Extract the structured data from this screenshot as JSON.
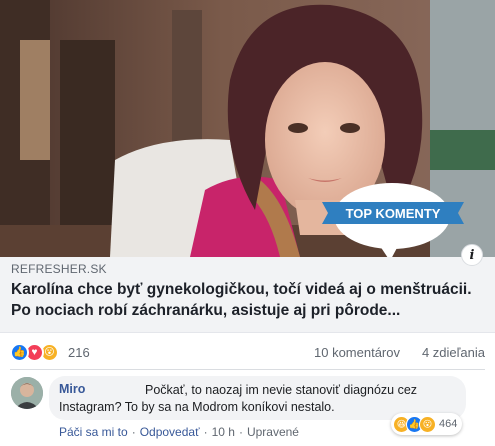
{
  "link_preview": {
    "domain": "REFRESHER.SK",
    "title": "Karolína chce byť gynekologičkou, točí videá aj o menštruácii. Po nociach robí záchranárku, asistuje aj pri pôrode..."
  },
  "badge": {
    "label": "TOP KOMENTY",
    "color": "#2f7fc0"
  },
  "info_button": {
    "label": "i"
  },
  "reactions": {
    "icons": [
      "like-icon",
      "love-icon",
      "wow-icon"
    ],
    "count": "216",
    "comments": "10 komentárov",
    "shares": "4 zdieľania"
  },
  "comment": {
    "author": "Miro",
    "text": "Počkať, to naozaj im nevie stanoviť diagnózu cez Instagram? To by sa na Modrom koníkovi nestalo.",
    "reaction_icons": [
      "haha-icon",
      "like-icon",
      "wow-icon"
    ],
    "reaction_count": "464",
    "actions": {
      "like": "Páči sa mi to",
      "reply": "Odpovedať",
      "time": "10 h",
      "edited": "Upravené"
    }
  },
  "colors": {
    "link_blue": "#385898",
    "meta_gray": "#606770",
    "card_bg": "#f2f3f5"
  }
}
